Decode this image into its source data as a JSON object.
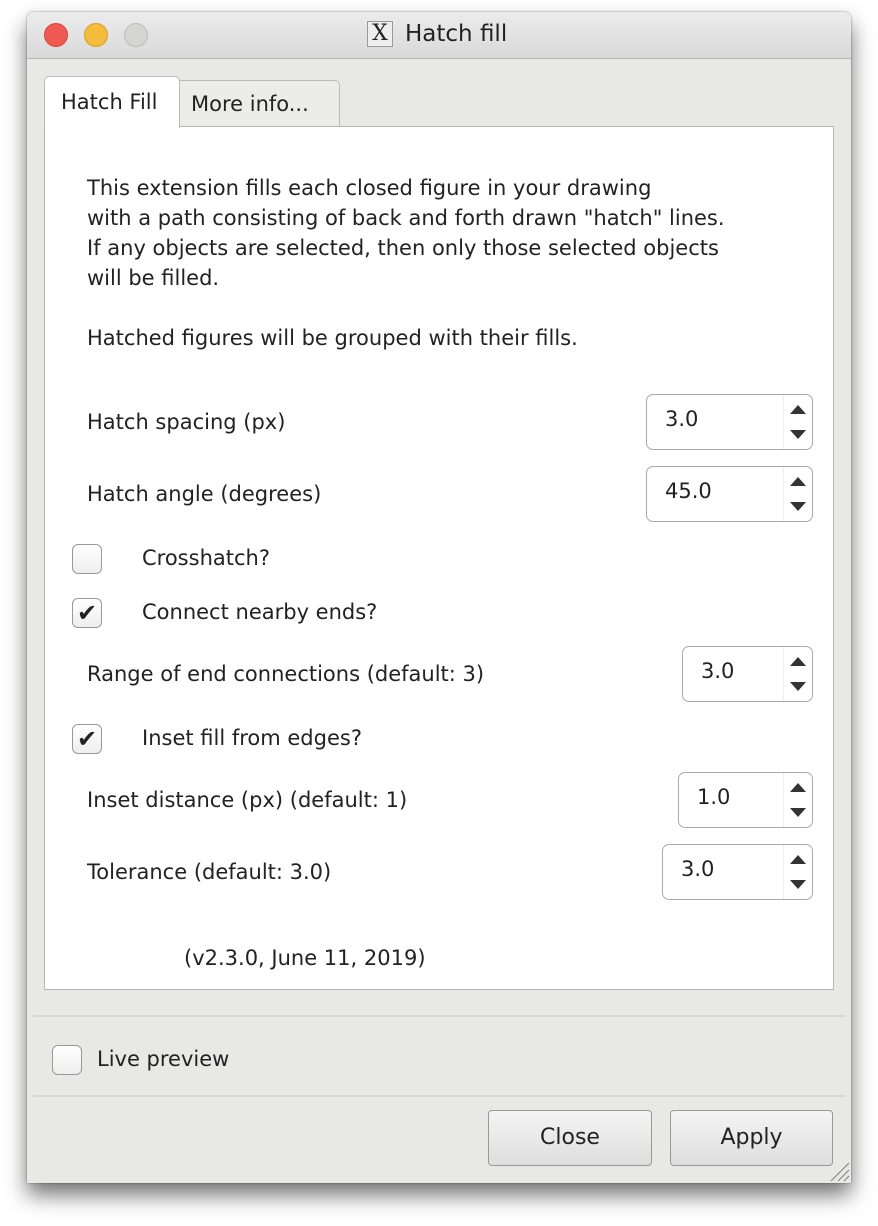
{
  "window": {
    "title": "Hatch fill",
    "app_icon": "x11-icon",
    "traffic_lights": {
      "close": "#ee5a52",
      "minimize": "#f4bb3c",
      "zoom": "#d5d5d3"
    }
  },
  "tabs": [
    {
      "label": "Hatch Fill",
      "active": true
    },
    {
      "label": "More info..."
    }
  ],
  "description": [
    "This extension fills each closed figure in your drawing",
    "with a path consisting of back and forth drawn \"hatch\" lines.",
    "If any objects are selected, then only those selected objects",
    "will be filled."
  ],
  "note": "Hatched figures will be grouped with their fills.",
  "fields": {
    "spacing": {
      "label": "Hatch spacing (px)",
      "value": "3.0"
    },
    "angle": {
      "label": "Hatch angle (degrees)",
      "value": "45.0"
    },
    "crosshatch": {
      "label": "Crosshatch?",
      "checked": false
    },
    "connect": {
      "label": "Connect nearby ends?",
      "checked": true
    },
    "range": {
      "label": "Range of end connections (default: 3)",
      "value": "3.0"
    },
    "inset": {
      "label": "Inset fill from edges?",
      "checked": true
    },
    "inset_distance": {
      "label": "Inset distance (px) (default: 1)",
      "value": "1.0"
    },
    "tolerance": {
      "label": "Tolerance (default: 3.0)",
      "value": "3.0"
    }
  },
  "version": "(v2.3.0, June 11, 2019)",
  "live_preview": {
    "label": "Live preview",
    "checked": false
  },
  "buttons": {
    "close": "Close",
    "apply": "Apply"
  },
  "check_glyph": "✔"
}
